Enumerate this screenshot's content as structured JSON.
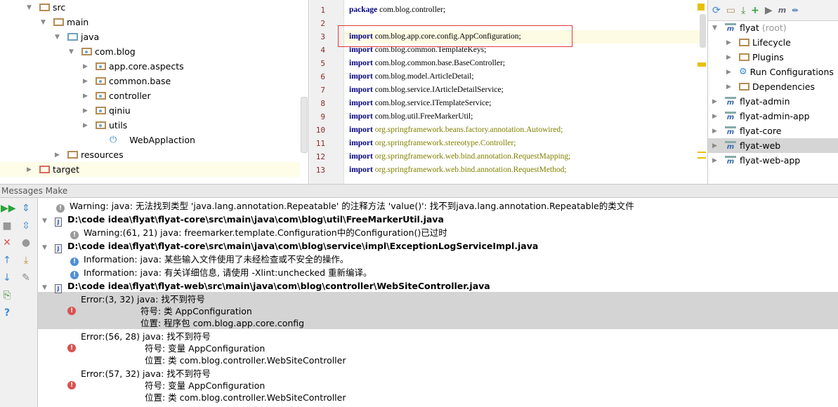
{
  "project_tree": [
    {
      "label": "src",
      "level": 0,
      "expanded": true,
      "icon": "folder-icon"
    },
    {
      "label": "main",
      "level": 1,
      "expanded": true,
      "icon": "folder-icon"
    },
    {
      "label": "java",
      "level": 2,
      "expanded": true,
      "icon": "source-folder-icon"
    },
    {
      "label": "com.blog",
      "level": 3,
      "expanded": true,
      "icon": "package-icon"
    },
    {
      "label": "app.core.aspects",
      "level": 4,
      "expanded": false,
      "icon": "package-icon"
    },
    {
      "label": "common.base",
      "level": 4,
      "expanded": false,
      "icon": "package-icon"
    },
    {
      "label": "controller",
      "level": 4,
      "expanded": false,
      "icon": "package-icon"
    },
    {
      "label": "qiniu",
      "level": 4,
      "expanded": false,
      "icon": "package-icon"
    },
    {
      "label": "utils",
      "level": 4,
      "expanded": false,
      "icon": "package-icon"
    },
    {
      "label": "WebApplaction",
      "level": 5,
      "icon": "spring-boot-class-icon"
    },
    {
      "label": "resources",
      "level": 2,
      "expanded": false,
      "icon": "resources-folder-icon"
    },
    {
      "label": "target",
      "level": 0,
      "expanded": false,
      "icon": "excluded-folder-icon"
    }
  ],
  "editor": {
    "lines": [
      {
        "n": "1",
        "kw": "package",
        "text": " com.blog.controller;",
        "ext": ""
      },
      {
        "n": "2",
        "kw": "",
        "text": "",
        "ext": ""
      },
      {
        "n": "3",
        "kw": "import",
        "text": " com.blog.app.core.config.AppConfiguration;",
        "ext": ""
      },
      {
        "n": "4",
        "kw": "import",
        "text": " com.blog.common.TemplateKeys;",
        "ext": ""
      },
      {
        "n": "5",
        "kw": "import",
        "text": " com.blog.common.base.BaseController;",
        "ext": ""
      },
      {
        "n": "6",
        "kw": "import",
        "text": " com.blog.model.ArticleDetail;",
        "ext": ""
      },
      {
        "n": "7",
        "kw": "import",
        "text": " com.blog.service.IArticleDetailService;",
        "ext": ""
      },
      {
        "n": "8",
        "kw": "import",
        "text": " com.blog.service.ITemplateService;",
        "ext": ""
      },
      {
        "n": "9",
        "kw": "import",
        "text": " com.blog.util.FreeMarkerUtil;",
        "ext": ""
      },
      {
        "n": "10",
        "kw": "import",
        "text": " ",
        "ext": "org.springframework.beans.factory.annotation.Autowired;"
      },
      {
        "n": "11",
        "kw": "import",
        "text": " ",
        "ext": "org.springframework.stereotype.Controller;"
      },
      {
        "n": "12",
        "kw": "import",
        "text": " ",
        "ext": "org.springframework.web.bind.annotation.RequestMapping;"
      },
      {
        "n": "13",
        "kw": "import",
        "text": " ",
        "ext": "org.springframework.web.bind.annotation.RequestMethod;"
      }
    ]
  },
  "maven": {
    "toolbar": [
      "reimport-icon",
      "generate-sources-icon",
      "download-icon",
      "add-icon",
      "run-icon",
      "maven-goal-icon",
      "toggle-offline-icon"
    ],
    "items": [
      {
        "label": "flyat",
        "suffix": "(root)",
        "level": 0,
        "expanded": true,
        "icon": "maven-module-icon"
      },
      {
        "label": "Lifecycle",
        "level": 1,
        "icon": "lifecycle-folder-icon"
      },
      {
        "label": "Plugins",
        "level": 1,
        "icon": "plugins-folder-icon"
      },
      {
        "label": "Run Configurations",
        "level": 1,
        "icon": "gear-icon"
      },
      {
        "label": "Dependencies",
        "level": 1,
        "icon": "dependencies-folder-icon"
      },
      {
        "label": "flyat-admin",
        "level": 0,
        "icon": "maven-module-icon"
      },
      {
        "label": "flyat-admin-app",
        "level": 0,
        "icon": "maven-module-icon"
      },
      {
        "label": "flyat-core",
        "level": 0,
        "icon": "maven-module-icon"
      },
      {
        "label": "flyat-web",
        "level": 0,
        "icon": "maven-module-icon",
        "selected": true
      },
      {
        "label": "flyat-web-app",
        "level": 0,
        "icon": "maven-module-icon"
      }
    ]
  },
  "messages": {
    "header": "Messages Make",
    "lines": [
      {
        "type": "warning",
        "text": "Warning: java: 无法找到类型 'java.lang.annotation.Repeatable' 的注释方法 'value()': 找不到java.lang.annotation.Repeatable的类文件"
      },
      {
        "type": "file",
        "text": "D:\\code idea\\flyat\\flyat-core\\src\\main\\java\\com\\blog\\util\\FreeMarkerUtil.java"
      },
      {
        "type": "warning",
        "text": "Warning:(61, 21)  java: freemarker.template.Configuration中的Configuration()已过时"
      },
      {
        "type": "file",
        "text": "D:\\code idea\\flyat\\flyat-core\\src\\main\\java\\com\\blog\\service\\impl\\ExceptionLogServiceImpl.java"
      },
      {
        "type": "info",
        "text": "Information: java: 某些输入文件使用了未经检查或不安全的操作。"
      },
      {
        "type": "info",
        "text": "Information: java: 有关详细信息, 请使用 -Xlint:unchecked 重新编译。"
      },
      {
        "type": "file",
        "text": "D:\\code idea\\flyat\\flyat-web\\src\\main\\java\\com\\blog\\controller\\WebSiteController.java"
      }
    ],
    "errors": [
      {
        "head": "Error:(3, 32)  java: 找不到符号",
        "symbol": "符号:   类 AppConfiguration",
        "location": "位置: 程序包 com.blog.app.core.config"
      },
      {
        "head": "Error:(56, 28)  java: 找不到符号",
        "symbol": "符号:   变量 AppConfiguration",
        "location": "位置: 类 com.blog.controller.WebSiteController"
      },
      {
        "head": "Error:(57, 32)  java: 找不到符号",
        "symbol": "符号:   变量 AppConfiguration",
        "location": "位置: 类 com.blog.controller.WebSiteController"
      }
    ]
  }
}
